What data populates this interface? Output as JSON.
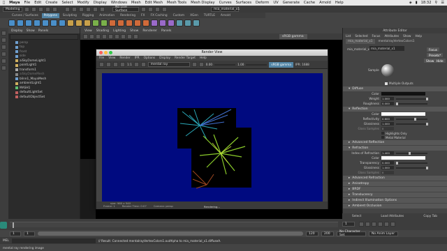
{
  "macbar": {
    "app": "Maya",
    "menus": [
      "File",
      "Edit",
      "Create",
      "Select",
      "Modify",
      "Display",
      "Windows",
      "Mesh",
      "Edit Mesh",
      "Mesh Tools",
      "Mesh Display",
      "Curves",
      "Surfaces",
      "Deform",
      "UV",
      "Generate",
      "Cache",
      "Arnold",
      "Help"
    ],
    "time": "18:32"
  },
  "status": {
    "mode": "Modeling",
    "live": "No Live Surface",
    "material_field": "mia_material_x1"
  },
  "shelf_tabs": [
    "Curves / Surfaces",
    "Polygons",
    "Sculpting",
    "Rigging",
    "Animation",
    "Rendering",
    "FX",
    "FX Caching",
    "Custom",
    "XGen",
    "TURTLE",
    "Arnold"
  ],
  "active_shelf": "Polygons",
  "outliner": {
    "menus": [
      "Display",
      "Show",
      "Panels"
    ],
    "items": [
      "persp",
      "top",
      "front",
      "side",
      "aiSkyDomeLight1",
      "pointLight1",
      "transform1",
      "aiSkyDomeMesh",
      "blinn1_MayaMesh",
      "ambientLight1",
      "MASH1",
      "defaultLightSet",
      "defaultObjectSet"
    ]
  },
  "viewport": {
    "menus": [
      "View",
      "Shading",
      "Lighting",
      "Show",
      "Renderer",
      "Panels"
    ],
    "gamma": "sRGB gamma"
  },
  "render_view": {
    "title": "Render View",
    "menus": [
      "File",
      "View",
      "Render",
      "IPR",
      "Options",
      "Display",
      "Render Target",
      "Help"
    ],
    "renderer": "mental ray",
    "zoom": "1:1",
    "val1": "0.00",
    "val2": "1.00",
    "gamma": "sRGB gamma",
    "ipr": "IPR: 1688",
    "size": "size: 960 x 540",
    "frame": "Frame: 1",
    "render_time": "Render Time: 0:07",
    "camera": "Camera: persp",
    "status": "Rendering..."
  },
  "attr_editor": {
    "title": "Attribute Editor",
    "menus": [
      "List",
      "Selected",
      "Focus",
      "Attributes",
      "Show",
      "Help"
    ],
    "tabs": [
      "mia_material_x1",
      "mentalrayVertexColors1"
    ],
    "node_label": "mia_material_x1",
    "focus": "Focus",
    "presets": "Presets*",
    "show": "Show",
    "hide": "Hide",
    "sample": "Sample",
    "multiple_outputs": "Multiple Outputs",
    "sections": {
      "diffuse": "Diffuse",
      "reflection": "Reflection",
      "adv_reflection": "Advanced Reflection",
      "refraction": "Refraction",
      "adv_refraction": "Advanced Refraction",
      "anisotropy": "Anisotropy",
      "brdf": "BRDF",
      "translucency": "Translucency",
      "indirect": "Indirect Illumination Options",
      "ao": "Ambient Occlusion"
    },
    "diffuse_rows": [
      {
        "label": "Color",
        "value": ""
      },
      {
        "label": "Weight",
        "value": "1.000"
      },
      {
        "label": "Roughness",
        "value": "0.000"
      }
    ],
    "reflection_rows": [
      {
        "label": "Color",
        "value": ""
      },
      {
        "label": "Reflectivity",
        "value": "0.600"
      },
      {
        "label": "Glossiness",
        "value": "1.000"
      },
      {
        "label": "Gloss Samples",
        "value": "8"
      }
    ],
    "highlights_only": "Highlights Only",
    "metal_material": "Metal Material",
    "refraction_rows": [
      {
        "label": "Index of Refraction",
        "value": "1.400"
      },
      {
        "label": "Color",
        "value": ""
      },
      {
        "label": "Transparency",
        "value": "0.000"
      },
      {
        "label": "Glossiness",
        "value": "1.000"
      },
      {
        "label": "Gloss Samples",
        "value": "8"
      }
    ],
    "buttons": [
      "Select",
      "Load Attributes",
      "Copy Tab"
    ]
  },
  "timeline": {
    "start": "1",
    "end": "120",
    "current": "1",
    "range_end1": "120",
    "range_end2": "200",
    "anim_layer": "No Anim Layer",
    "char_set": "No Character Set"
  },
  "cmdline": {
    "lang": "MEL",
    "result": "// Result: Connected mentalrayVertexColors1.outAlpha to mia_material_x1.diffuseA.",
    "help": "mental ray rendering image"
  }
}
